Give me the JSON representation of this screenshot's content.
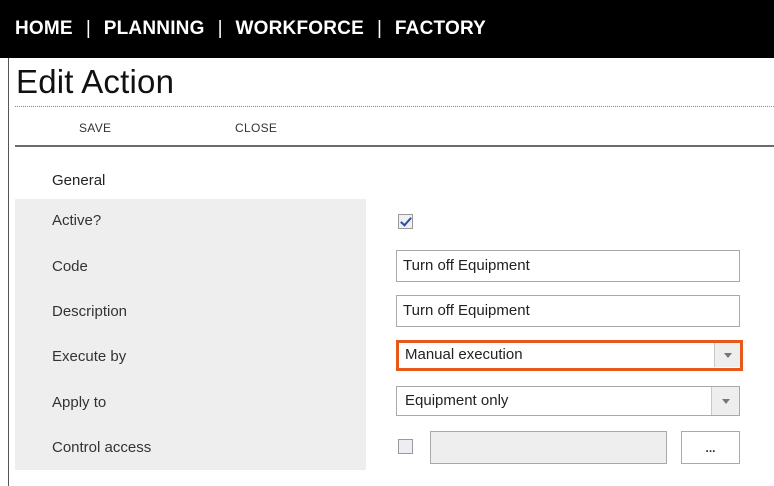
{
  "nav": {
    "items": [
      "HOME",
      "PLANNING",
      "WORKFORCE",
      "FACTORY"
    ],
    "separator": "|"
  },
  "page": {
    "title": "Edit Action"
  },
  "toolbar": {
    "save_label": "SAVE",
    "close_label": "CLOSE"
  },
  "form": {
    "section_title": "General",
    "active": {
      "label": "Active?",
      "checked": true
    },
    "code": {
      "label": "Code",
      "value": "Turn off Equipment"
    },
    "description": {
      "label": "Description",
      "value": "Turn off Equipment"
    },
    "execute_by": {
      "label": "Execute by",
      "value": "Manual execution",
      "highlight_color": "#e8581a"
    },
    "apply_to": {
      "label": "Apply to",
      "value": "Equipment only"
    },
    "control_access": {
      "label": "Control access",
      "checked": false,
      "value": "",
      "lookup_button_label": "..."
    }
  },
  "colors": {
    "nav_background": "#000000",
    "highlight": "#e8581a",
    "label_panel": "#eeeeee"
  }
}
